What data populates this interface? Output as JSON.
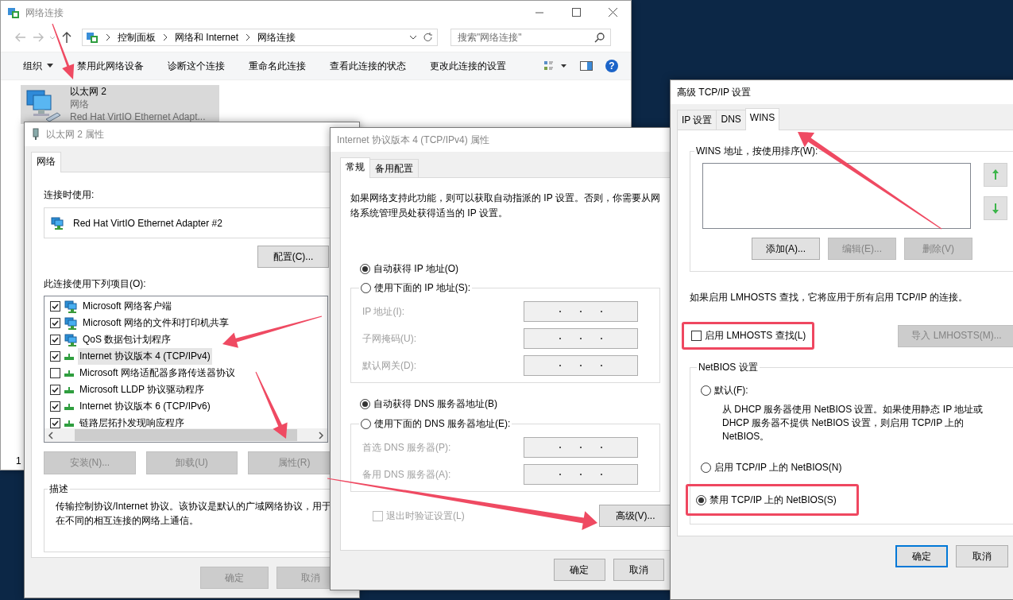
{
  "explorer": {
    "title": "网络连接",
    "breadcrumb": [
      "控制面板",
      "网络和 Internet",
      "网络连接"
    ],
    "search": {
      "placeholder": "搜索\"网络连接\""
    },
    "commands": [
      {
        "label": "组织",
        "kind": "menu"
      },
      {
        "label": "禁用此网络设备",
        "kind": "command"
      },
      {
        "label": "诊断这个连接",
        "kind": "command"
      },
      {
        "label": "重命名此连接",
        "kind": "command"
      },
      {
        "label": "查看此连接的状态",
        "kind": "command"
      },
      {
        "label": "更改此连接的设置",
        "kind": "command"
      }
    ],
    "help": "?",
    "connections": [
      {
        "name": "以太网 2",
        "status": "网络",
        "adapter": "Red Hat VirtIO Ethernet Adapt...",
        "selected": true
      }
    ],
    "status_bar": "1"
  },
  "adapter_properties": {
    "title": "以太网 2 属性",
    "tabs": [
      {
        "label": "网络",
        "selected": true
      }
    ],
    "connect_using": "连接时使用:",
    "adapter": "Red Hat VirtIO Ethernet Adapter #2",
    "configure": "配置(C)...",
    "items_label": "此连接使用下列项目(O):",
    "components": [
      {
        "label": "Microsoft 网络客户端",
        "kind": "client",
        "checked": true,
        "selected": false
      },
      {
        "label": "Microsoft 网络的文件和打印机共享",
        "kind": "service",
        "checked": true,
        "selected": false
      },
      {
        "label": "QoS 数据包计划程序",
        "kind": "service",
        "checked": true,
        "selected": false
      },
      {
        "label": "Internet 协议版本 4 (TCP/IPv4)",
        "kind": "protocol",
        "checked": true,
        "selected": true
      },
      {
        "label": "Microsoft 网络适配器多路传送器协议",
        "kind": "protocol",
        "checked": false,
        "selected": false
      },
      {
        "label": "Microsoft LLDP 协议驱动程序",
        "kind": "protocol",
        "checked": true,
        "selected": false
      },
      {
        "label": "Internet 协议版本 6 (TCP/IPv6)",
        "kind": "protocol",
        "checked": true,
        "selected": false
      },
      {
        "label": "链路层拓扑发现响应程序",
        "kind": "protocol",
        "checked": true,
        "selected": false
      }
    ],
    "buttons": [
      {
        "label": "安装(N)...",
        "disabled": true
      },
      {
        "label": "卸载(U)",
        "disabled": true
      },
      {
        "label": "属性(R)",
        "disabled": true
      }
    ],
    "description": {
      "title": "描述",
      "text": "传输控制协议/Internet 协议。该协议是默认的广域网络协议，用于在不同的相互连接的网络上通信。"
    },
    "dialog_buttons": [
      {
        "label": "确定",
        "disabled": true
      },
      {
        "label": "取消",
        "disabled": true
      }
    ]
  },
  "ipv4_properties": {
    "title": "Internet 协议版本 4 (TCP/IPv4) 属性",
    "tabs": [
      {
        "label": "常规",
        "selected": true
      },
      {
        "label": "备用配置",
        "selected": false
      }
    ],
    "intro": "如果网络支持此功能，则可以获取自动指派的 IP 设置。否则，你需要从网络系统管理员处获得适当的 IP 设置。",
    "ip_mode": [
      {
        "label": "自动获得 IP 地址(O)",
        "selected": true
      },
      {
        "label": "使用下面的 IP 地址(S):",
        "selected": false
      }
    ],
    "ip_fields": [
      {
        "label": "IP 地址(I):",
        "disabled": true
      },
      {
        "label": "子网掩码(U):",
        "disabled": true
      },
      {
        "label": "默认网关(D):",
        "disabled": true
      }
    ],
    "dns_mode": [
      {
        "label": "自动获得 DNS 服务器地址(B)",
        "selected": true
      },
      {
        "label": "使用下面的 DNS 服务器地址(E):",
        "selected": false
      }
    ],
    "dns_fields": [
      {
        "label": "首选 DNS 服务器(P):",
        "disabled": true
      },
      {
        "label": "备用 DNS 服务器(A):",
        "disabled": true
      }
    ],
    "validate": {
      "label": "退出时验证设置(L)",
      "checked": false,
      "disabled": true
    },
    "advanced": "高级(V)...",
    "dialog_buttons": [
      {
        "label": "确定",
        "default": false
      },
      {
        "label": "取消",
        "default": false
      }
    ]
  },
  "advanced_tcpip": {
    "title": "高级 TCP/IP 设置",
    "tabs": [
      {
        "label": "IP 设置",
        "selected": false
      },
      {
        "label": "DNS",
        "selected": false
      },
      {
        "label": "WINS",
        "selected": true
      }
    ],
    "wins_group": "WINS 地址，按使用排序(W):",
    "list_buttons": [
      {
        "label": "添加(A)...",
        "disabled": false
      },
      {
        "label": "编辑(E)...",
        "disabled": true
      },
      {
        "label": "删除(V)",
        "disabled": true
      }
    ],
    "lmhosts_note": "如果启用 LMHOSTS 查找，它将应用于所有启用 TCP/IP 的连接。",
    "lmhosts": {
      "label": "启用 LMHOSTS 查找(L)",
      "checked": false,
      "highlighted": true
    },
    "import": {
      "label": "导入 LMHOSTS(M)...",
      "disabled": true
    },
    "netbios": {
      "title": "NetBIOS 设置",
      "options": [
        {
          "label": "默认(F):",
          "selected": false,
          "highlighted": false,
          "description": "从 DHCP 服务器使用 NetBIOS 设置。如果使用静态 IP 地址或 DHCP 服务器不提供 NetBIOS 设置，则启用 TCP/IP 上的 NetBIOS。"
        },
        {
          "label": "启用 TCP/IP 上的 NetBIOS(N)",
          "selected": false,
          "highlighted": false
        },
        {
          "label": "禁用 TCP/IP 上的 NetBIOS(S)",
          "selected": true,
          "highlighted": true
        }
      ]
    },
    "dialog_buttons": [
      {
        "label": "确定",
        "default": true
      },
      {
        "label": "取消",
        "default": false
      }
    ]
  }
}
